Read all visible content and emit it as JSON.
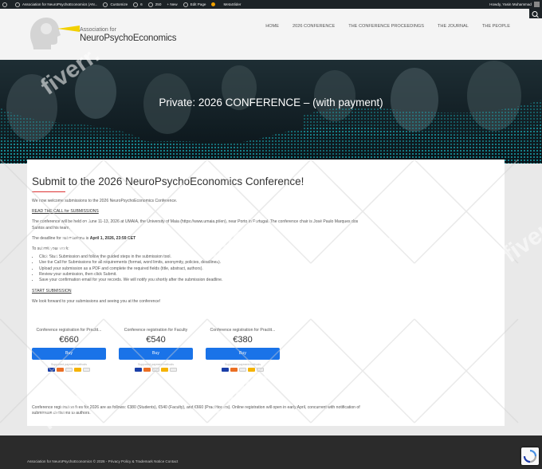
{
  "admin_bar": {
    "site_name": "Association for NeuroPsychoEconomics (AN...",
    "customize": "Customize",
    "comments_count": "6",
    "updates_count": "250",
    "new_label": "+ New",
    "edit_page": "Edit Page",
    "metaslider": "MetaSlider",
    "howdy": "Howdy, Yasin Muhammad"
  },
  "header": {
    "logo_line1": "Association for",
    "logo_line2": "NeuroPsychoEconomics",
    "nav": [
      "HOME",
      "2026 CONFERENCE",
      "THE CONFERENCE PROCEEDINGS",
      "THE JOURNAL",
      "THE PEOPLE"
    ]
  },
  "hero": {
    "title": "Private: 2026 CONFERENCE – (with payment)"
  },
  "content": {
    "heading": "Submit to the 2026 NeuroPsychoEconomics Conference!",
    "welcome": "We now welcome submissions to the 2026 NeuroPsychoEconomics Conference.",
    "read_call": "READ THE CALL for SUBMISSIONS",
    "held": "The conference will be held on June 11-13, 2026 at UMAIA, the University of Maia (https://www.umaia.pt/en), near Porto in Portugal. The conference chair is José Paulo Marques dos Santos and his team.",
    "deadline_prefix": "The deadline for submissions is ",
    "deadline": "April 1, 2026, 23:59 CET",
    "to_submit": "To submit your work:",
    "steps": [
      "Click Start Submission and follow the guided steps in the submission tool.",
      "Use the Call for Submissions for all requirements (format, word limits, anonymity, policies, deadlines).",
      "Upload your submission as a PDF and complete the required fields (title, abstract, authors).",
      "Review your submission, then click Submit.",
      "Save your confirmation email for your records. We will notify you shortly after the submission deadline."
    ],
    "start_submission": "START SUBMISSION",
    "look_forward": "We look forward to your submissions and seeing you at the conference!",
    "footnote": "Conference registration fees for 2026 are as follows: €380 (Students), €540 (Faculty), and €660 (Practitioners). Online registration will open in early April, concurrent with notification of submission decisions to authors."
  },
  "prices": [
    {
      "title": "Conference registration for Practit...",
      "amount": "€660",
      "button": "Buy",
      "methods": "Supported payment methods"
    },
    {
      "title": "Conference registration for Faculty",
      "amount": "€540",
      "button": "Buy",
      "methods": "Supported payment methods"
    },
    {
      "title": "Conference registration for Practit...",
      "amount": "€380",
      "button": "Buy",
      "methods": "Supported payment methods"
    }
  ],
  "footer": {
    "text": "Association for NeuroPsychoEconomics © 2026 -   Privacy Policy & Trademark Notice   Contact"
  },
  "colors": {
    "accent": "#1a73e8",
    "admin_bar": "#1d2327",
    "hero_teal": "#17a4b0",
    "underline": "#dd3333"
  },
  "watermark": "fiverr."
}
